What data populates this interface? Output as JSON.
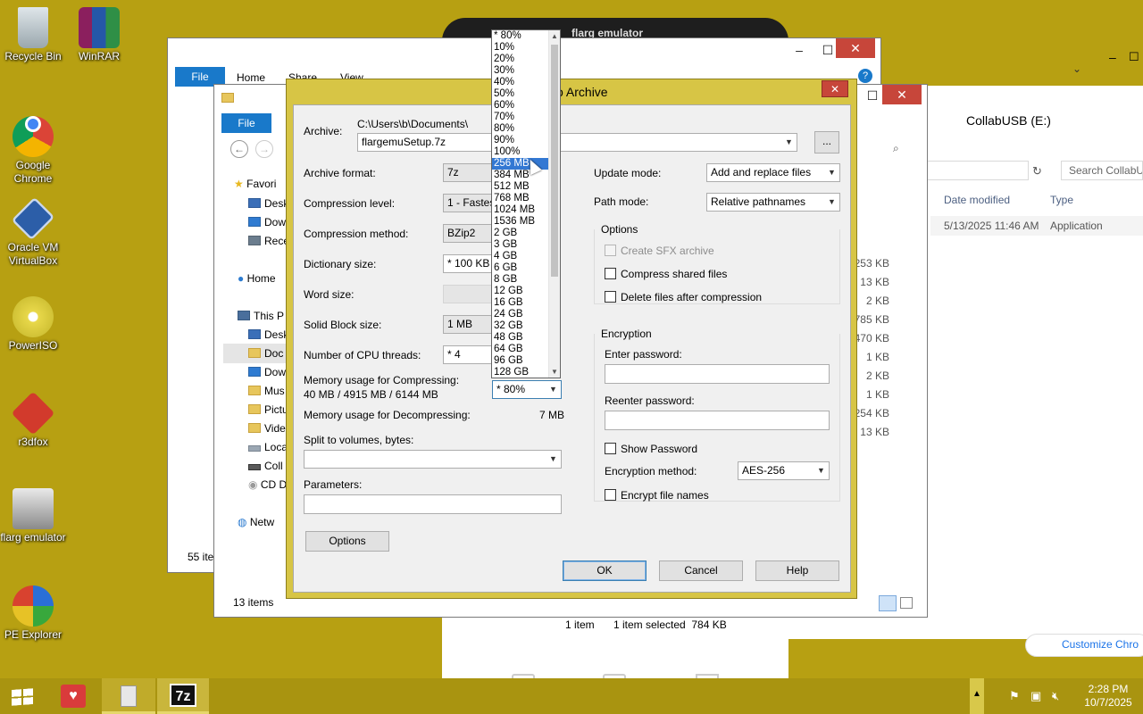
{
  "desktop": {
    "icons": [
      {
        "label": "Recycle Bin"
      },
      {
        "label": "WinRAR"
      },
      {
        "label": "Google Chrome"
      },
      {
        "label": "Oracle VM VirtualBox"
      },
      {
        "label": "PowerISO"
      },
      {
        "label": "r3dfox"
      },
      {
        "label": "flarg emulator"
      },
      {
        "label": "PE Explorer"
      }
    ]
  },
  "flarg_window": {
    "title": "flarg emulator"
  },
  "explorer_back": {
    "tabs": {
      "file": "File",
      "home": "Home",
      "share": "Share",
      "view": "View"
    },
    "status_items": "55 ite"
  },
  "explorer_mid": {
    "file_tab": "File",
    "tree": [
      "Favori",
      "Desk",
      "Dow",
      "Rece",
      "Home",
      "This P",
      "Desk",
      "Doc",
      "Dow",
      "Mus",
      "Pictu",
      "Vide",
      "Loca",
      "Coll",
      "CD D",
      "Netw"
    ],
    "status": "13 items"
  },
  "explorer_right": {
    "title": "CollabUSB (E:)",
    "search_placeholder": "Search CollabUS",
    "col_date": "Date modified",
    "col_type": "Type",
    "row_date": "5/13/2025 11:46 AM",
    "row_type": "Application",
    "sizes": [
      "253 KB",
      "13 KB",
      "2 KB",
      "785 KB",
      "470 KB",
      "1 KB",
      "2 KB",
      "1 KB",
      "254 KB",
      "13 KB"
    ],
    "status_count": "1 item",
    "status_selected": "1 item selected  784 KB"
  },
  "chrome_tab": {
    "customize": "Customize Chro"
  },
  "dialog": {
    "title": "o Archive",
    "archive_label": "Archive:",
    "archive_path": "C:\\Users\\b\\Documents\\",
    "archive_name": "flargemuSetup.7z",
    "browse": "...",
    "format_label": "Archive format:",
    "format_value": "7z",
    "level_label": "Compression level:",
    "level_value": "1 - Fastest",
    "method_label": "Compression method:",
    "method_value": "BZip2",
    "dict_label": "Dictionary size:",
    "dict_value": "* 100 KB",
    "word_label": "Word size:",
    "solid_label": "Solid Block size:",
    "solid_value": "1 MB",
    "cpu_label": "Number of CPU threads:",
    "cpu_value": "* 4",
    "mem_comp_label": "Memory usage for Compressing:",
    "mem_comp_value": "40 MB / 4915 MB / 6144 MB",
    "mem_combo_value": "* 80%",
    "mem_decomp_label": "Memory usage for Decompressing:",
    "mem_decomp_value": "7 MB",
    "split_label": "Split to volumes, bytes:",
    "params_label": "Parameters:",
    "options_button": "Options",
    "update_label": "Update mode:",
    "update_value": "Add and replace files",
    "path_label": "Path mode:",
    "path_value": "Relative pathnames",
    "options_group": "Options",
    "sfx": "Create SFX archive",
    "shared": "Compress shared files",
    "delete": "Delete files after compression",
    "encryption_group": "Encryption",
    "enter_pw": "Enter password:",
    "reenter_pw": "Reenter password:",
    "show_pw": "Show Password",
    "enc_method_label": "Encryption method:",
    "enc_method_value": "AES-256",
    "encrypt_names": "Encrypt file names",
    "ok": "OK",
    "cancel": "Cancel",
    "help": "Help"
  },
  "dropdown": {
    "options": [
      "* 80%",
      "10%",
      "20%",
      "30%",
      "40%",
      "50%",
      "60%",
      "70%",
      "80%",
      "90%",
      "100%",
      "256 MB",
      "384 MB",
      "512 MB",
      "768 MB",
      "1024 MB",
      "1536 MB",
      "2 GB",
      "3 GB",
      "4 GB",
      "6 GB",
      "8 GB",
      "12 GB",
      "16 GB",
      "24 GB",
      "32 GB",
      "48 GB",
      "64 GB",
      "96 GB",
      "128 GB"
    ],
    "highlighted": "256 MB"
  },
  "taskbar": {
    "time": "2:28 PM",
    "date": "10/7/2025",
    "start_icon": "windows-logo-icon",
    "app_icons": [
      "heart-monitor-icon",
      "file-explorer-icon",
      "7zip-icon"
    ]
  }
}
